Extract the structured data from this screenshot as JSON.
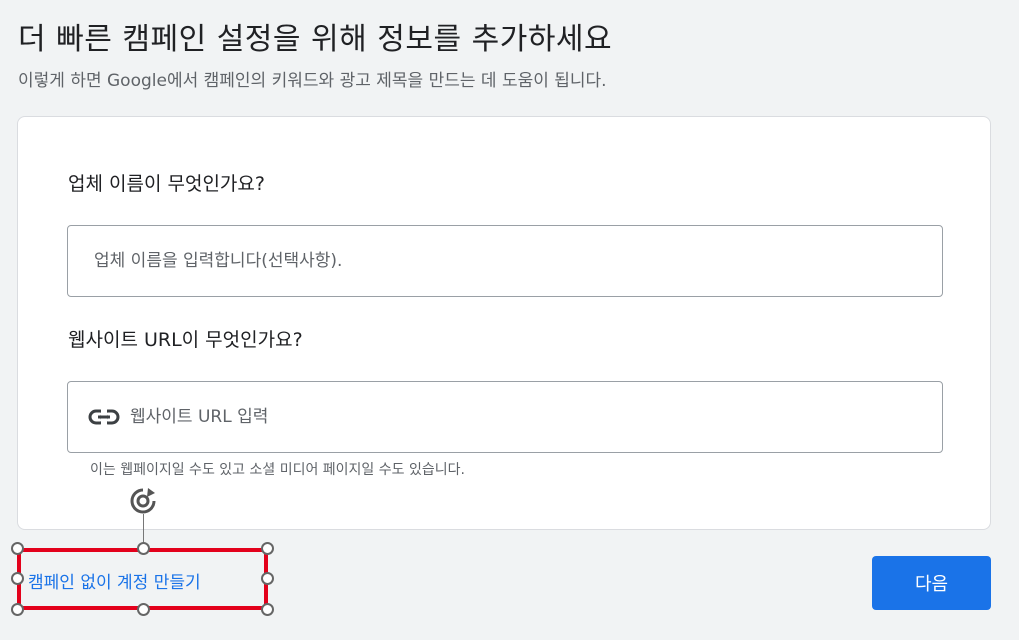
{
  "header": {
    "title": "더 빠른 캠페인 설정을 위해 정보를 추가하세요",
    "subtitle": "이렇게 하면 Google에서 캠페인의 키워드와 광고 제목을 만드는 데 도움이 됩니다."
  },
  "form": {
    "business_question": "업체 이름이 무엇인가요?",
    "business_placeholder": "업체 이름을 입력합니다(선택사항).",
    "business_value": "",
    "website_question": "웹사이트 URL이 무엇인가요?",
    "website_placeholder": "웹사이트 URL 입력",
    "website_value": "",
    "website_hint": "이는 웹페이지일 수도 있고 소셜 미디어 페이지일 수도 있습니다."
  },
  "footer": {
    "skip_link": "캠페인 없이 계정 만들기",
    "next_button": "다음"
  },
  "icons": {
    "website_field_icon": "link-icon",
    "rotate_handle_icon": "rotate-icon"
  },
  "colors": {
    "accent": "#1a73e8",
    "selection_border": "#e3001b",
    "background": "#f1f3f4"
  }
}
